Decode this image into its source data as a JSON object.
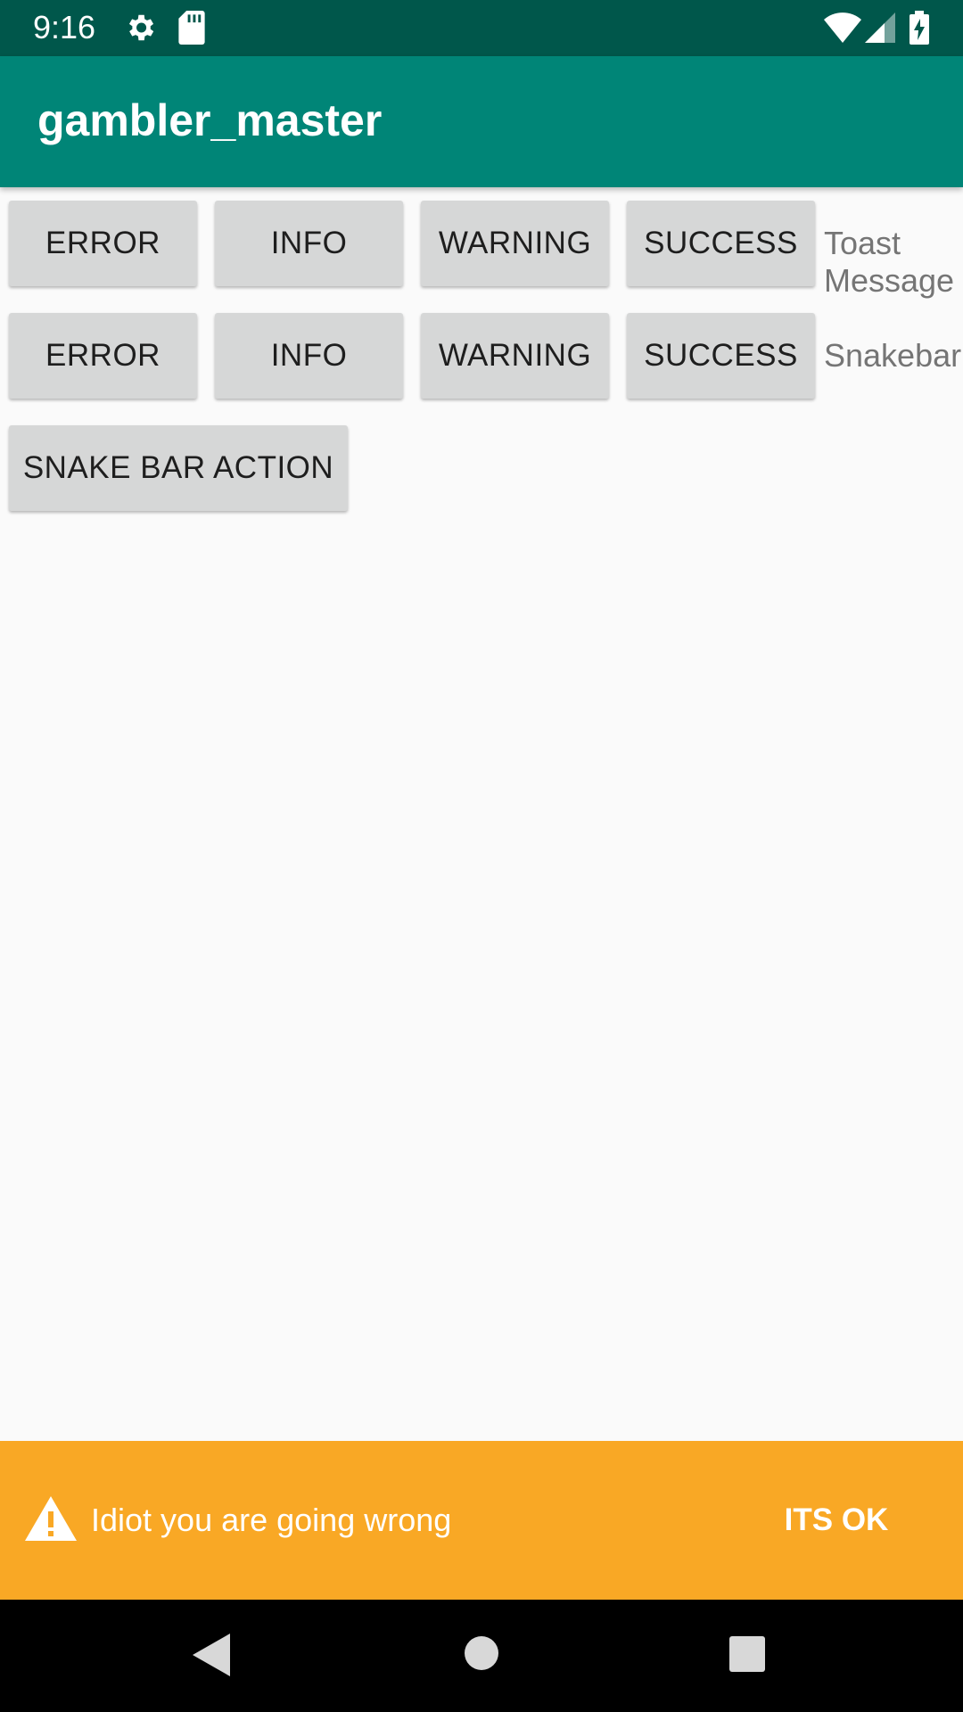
{
  "status_bar": {
    "time": "9:16",
    "icons": [
      "settings-icon",
      "sd-card-icon",
      "wifi-icon",
      "signal-icon",
      "battery-charging-icon"
    ]
  },
  "app_bar": {
    "title": "gambler_master"
  },
  "toast_row": {
    "buttons": [
      "ERROR",
      "INFO",
      "WARNING",
      "SUCCESS"
    ],
    "label": "Toast Message"
  },
  "snakebar_row": {
    "buttons": [
      "ERROR",
      "INFO",
      "WARNING",
      "SUCCESS"
    ],
    "label": "Snakebar"
  },
  "snake_bar_action_button": "SNAKE BAR ACTION",
  "snackbar": {
    "icon": "warning-icon",
    "message": "Idiot you are going wrong",
    "action": "ITS OK",
    "background": "#f9a825"
  },
  "nav_bar": {
    "icons": [
      "back-icon",
      "home-icon",
      "recents-icon"
    ]
  },
  "colors": {
    "status_bar": "#00574b",
    "app_bar": "#008577",
    "button": "#d6d7d7",
    "background": "#fafafa"
  }
}
